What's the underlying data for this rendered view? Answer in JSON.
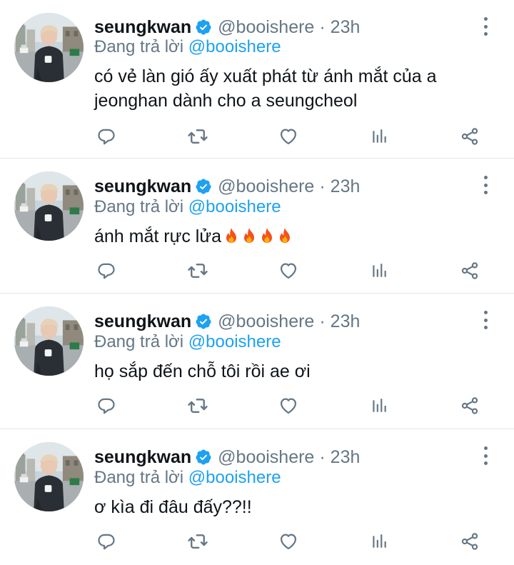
{
  "colors": {
    "accent": "#1da1f2",
    "secondary": "#657786",
    "text": "#0f1419",
    "divider": "#e1e8ed"
  },
  "icons": [
    "avatar-photo",
    "verified-badge-icon",
    "more-vertical-icon",
    "reply-icon",
    "retweet-icon",
    "like-icon",
    "stats-icon",
    "share-icon",
    "fire-emoji"
  ],
  "tweets": [
    {
      "name": "seungkwan",
      "handle": "@booishere",
      "dot": "·",
      "time": "23h",
      "reply_prefix": "Đang trả lời",
      "reply_handle": "@booishere",
      "text": "có vẻ làn gió ấy xuất phát từ ánh mắt của a jeonghan dành cho a seungcheol"
    },
    {
      "name": "seungkwan",
      "handle": "@booishere",
      "dot": "·",
      "time": "23h",
      "reply_prefix": "Đang trả lời",
      "reply_handle": "@booishere",
      "text": "ánh mắt rực lửa"
    },
    {
      "name": "seungkwan",
      "handle": "@booishere",
      "dot": "·",
      "time": "23h",
      "reply_prefix": "Đang trả lời",
      "reply_handle": "@booishere",
      "text": "họ sắp đến chỗ tôi rồi ae ơi"
    },
    {
      "name": "seungkwan",
      "handle": "@booishere",
      "dot": "·",
      "time": "23h",
      "reply_prefix": "Đang trả lời",
      "reply_handle": "@booishere",
      "text": "ơ kìa đi đâu đấy??!!"
    }
  ]
}
